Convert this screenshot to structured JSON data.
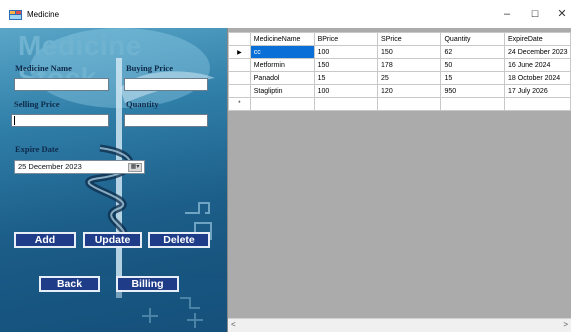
{
  "window": {
    "title": "Medicine",
    "controls": {
      "minimize": "–",
      "maximize": "☐",
      "close": "✕"
    }
  },
  "form": {
    "heading": "Medicine Stock",
    "medicine_name_label": "Medicine Name",
    "medicine_name_value": "",
    "buying_price_label": "Buying Price",
    "buying_price_value": "",
    "selling_price_label": "Selling Price",
    "selling_price_value": "",
    "quantity_label": "Quantity",
    "quantity_value": "",
    "expire_date_label": "Expire Date",
    "expire_date_value": "25 December 2023"
  },
  "buttons": {
    "add": "Add",
    "update": "Update",
    "delete": "Delete",
    "back": "Back",
    "billing": "Billing"
  },
  "grid": {
    "columns": [
      "MedicineName",
      "BPrice",
      "SPrice",
      "Quantity",
      "ExpireDate"
    ],
    "rows": [
      [
        "cc",
        "100",
        "150",
        "62",
        "24 December 2023"
      ],
      [
        "Metformin",
        "150",
        "178",
        "50",
        "16 June 2024"
      ],
      [
        "Panadol",
        "15",
        "25",
        "15",
        "18 October 2024"
      ],
      [
        "Stagliptin",
        "100",
        "120",
        "950",
        "17 July 2026"
      ]
    ],
    "current_row_marker": "▶",
    "new_row_marker": "*",
    "scroll_left": "<",
    "scroll_right": ">"
  },
  "colors": {
    "button_bg": "#1f3c88",
    "selection": "#0a6fd6",
    "heading": "#6fb3d0"
  }
}
